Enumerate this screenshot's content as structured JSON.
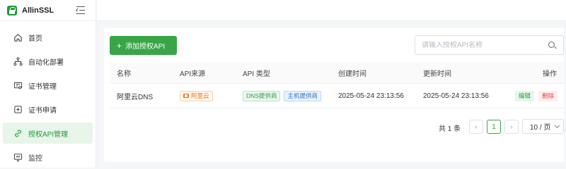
{
  "app": {
    "name": "AllinSSL"
  },
  "sidebar": {
    "items": [
      {
        "label": "首页",
        "icon": "home-icon",
        "active": false
      },
      {
        "label": "自动化部署",
        "icon": "workflow-icon",
        "active": false
      },
      {
        "label": "证书管理",
        "icon": "certificate-icon",
        "active": false
      },
      {
        "label": "证书申请",
        "icon": "plus-square-icon",
        "active": false
      },
      {
        "label": "授权API管理",
        "icon": "api-link-icon",
        "active": true
      },
      {
        "label": "监控",
        "icon": "monitor-icon",
        "active": false
      }
    ]
  },
  "toolbar": {
    "add_label": "添加授权API",
    "search_placeholder": "请输入授权API名称"
  },
  "table": {
    "columns": [
      "名称",
      "API来源",
      "API 类型",
      "创建时间",
      "更新时间",
      "操作"
    ],
    "rows": [
      {
        "name": "阿里云DNS",
        "source": "阿里云",
        "types": [
          "DNS提供商",
          "主机提供商"
        ],
        "created": "2025-05-24 23:13:56",
        "updated": "2025-05-24 23:13:56",
        "edit_label": "编辑",
        "delete_label": "删除"
      }
    ]
  },
  "pagination": {
    "total_text": "共 1 条",
    "prev": "‹",
    "current": "1",
    "next": "›",
    "page_size": "10 / 页"
  },
  "colors": {
    "brand": "#3aa547",
    "active_bg": "#e8f5ea",
    "danger": "#e0474c"
  }
}
